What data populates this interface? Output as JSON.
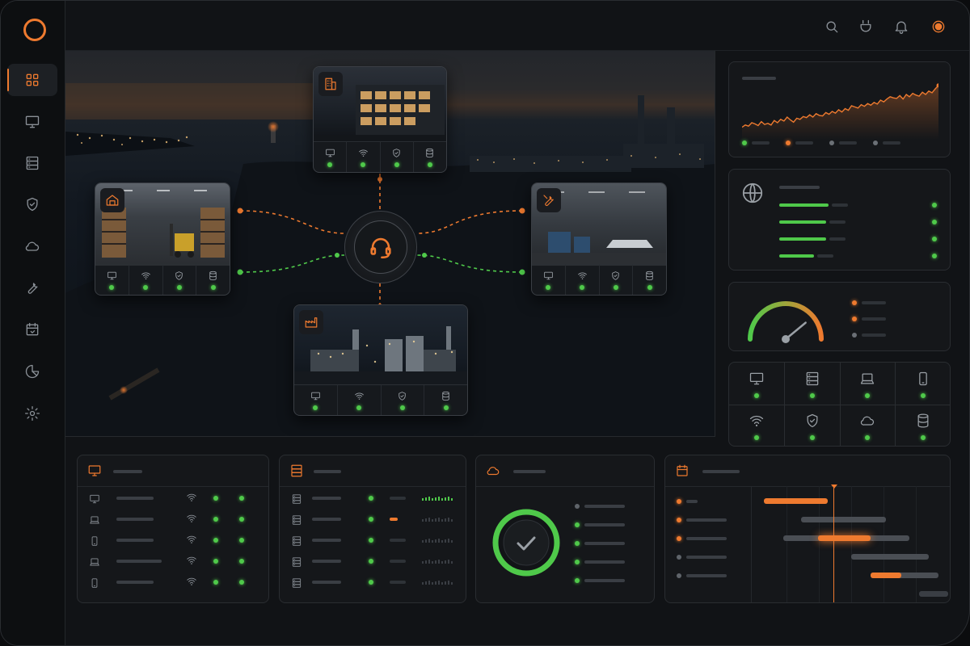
{
  "app": {
    "accent": "#ee7a2f",
    "ok_color": "#4fc94a",
    "panel_color": "#15171a"
  },
  "sidebar": {
    "items": [
      {
        "icon": "grid-icon",
        "active": true
      },
      {
        "icon": "monitor-icon",
        "active": false
      },
      {
        "icon": "server-icon",
        "active": false
      },
      {
        "icon": "shield-icon",
        "active": false
      },
      {
        "icon": "cloud-icon",
        "active": false
      },
      {
        "icon": "wrench-icon",
        "active": false
      },
      {
        "icon": "calendar-icon",
        "active": false
      },
      {
        "icon": "pie-chart-icon",
        "active": false
      },
      {
        "icon": "gear-icon",
        "active": false
      }
    ]
  },
  "topbar": {
    "icons": [
      "search-icon",
      "plug-icon",
      "bell-icon",
      "status-indicator-icon"
    ]
  },
  "map": {
    "hub_icon": "headset-icon",
    "sites": [
      {
        "name": "office-building",
        "icon": "building-icon",
        "status": [
          "ok",
          "ok",
          "ok",
          "ok"
        ]
      },
      {
        "name": "warehouse",
        "icon": "home-icon",
        "status": [
          "ok",
          "ok",
          "ok",
          "ok"
        ]
      },
      {
        "name": "workshop",
        "icon": "tools-icon",
        "status": [
          "ok",
          "ok",
          "ok",
          "ok"
        ]
      },
      {
        "name": "factory",
        "icon": "factory-icon",
        "status": [
          "ok",
          "ok",
          "ok",
          "ok"
        ]
      }
    ],
    "status_icons": [
      "monitor-icon",
      "wifi-icon",
      "shield-icon",
      "database-icon"
    ]
  },
  "trend_panel": {
    "chart_data": {
      "type": "area",
      "values": [
        22,
        26,
        24,
        30,
        28,
        25,
        32,
        27,
        29,
        26,
        34,
        30,
        36,
        33,
        40,
        35,
        31,
        38,
        36,
        41,
        39,
        44,
        40,
        46,
        43,
        42,
        48,
        45,
        50,
        47,
        53,
        49,
        55,
        52,
        60,
        58,
        56,
        62,
        59,
        64,
        61,
        66,
        63,
        70,
        67,
        72,
        76,
        74,
        73,
        78,
        72,
        80,
        76,
        82,
        79,
        77,
        84,
        80,
        86,
        83,
        90,
        96
      ],
      "ylim": [
        0,
        100
      ],
      "grid": false
    },
    "legend_colors": [
      "#4fc94a",
      "#ee7a2f",
      "#6b7076",
      "#6b7076"
    ]
  },
  "network_panel": {
    "icon": "globe-icon",
    "bars": [
      0.85,
      0.8,
      0.8,
      0.6
    ]
  },
  "gauge_panel": {
    "value": 0.78,
    "legend_colors": [
      "#ee7a2f",
      "#ee7a2f",
      "#6b7076"
    ]
  },
  "device_grid": {
    "icons": [
      "monitor-icon",
      "server-icon",
      "laptop-icon",
      "phone-icon",
      "wifi-icon",
      "shield-icon",
      "cloud-icon",
      "database-icon"
    ]
  },
  "endpoints_panel": {
    "icon": "monitor-icon",
    "rows": [
      {
        "icon": "monitor-icon"
      },
      {
        "icon": "laptop-icon"
      },
      {
        "icon": "phone-icon"
      },
      {
        "icon": "laptop-icon"
      },
      {
        "icon": "phone-icon"
      }
    ]
  },
  "servers_panel": {
    "icon": "server-icon",
    "rows": [
      {
        "load_level": 5,
        "bar_color": "#4fc94a"
      },
      {
        "load_level": 1,
        "bar_color": "#ee7a2f"
      },
      {
        "load_level": 0,
        "bar_color": "#4fc94a"
      },
      {
        "load_level": 0,
        "bar_color": "#4fc94a"
      },
      {
        "load_level": 0,
        "bar_color": "#4fc94a"
      }
    ]
  },
  "cloud_panel": {
    "icon": "cloud-icon",
    "progress": 1.0,
    "rows": 5
  },
  "schedule_panel": {
    "icon": "calendar-icon",
    "rows": [
      {
        "dot": "orange",
        "start": 0.05,
        "end": 0.38,
        "color": "#ee7a2f"
      },
      {
        "dot": "orange",
        "start": 0.24,
        "end": 0.68,
        "color": "#4a4e54"
      },
      {
        "dot": "orange",
        "start": 0.15,
        "end": 0.8,
        "color": "#4a4e54",
        "highlight": [
          0.33,
          0.6
        ]
      },
      {
        "dot": "gray",
        "start": 0.5,
        "end": 0.9,
        "color": "#4a4e54"
      },
      {
        "dot": "gray",
        "start": 0.6,
        "end": 0.95,
        "color": "#4a4e54",
        "highlight": [
          0.6,
          0.76
        ]
      },
      {
        "dot": "gray",
        "start": 0.85,
        "end": 1.0,
        "color": "#3a3e44"
      }
    ],
    "now_marker": 0.41
  }
}
